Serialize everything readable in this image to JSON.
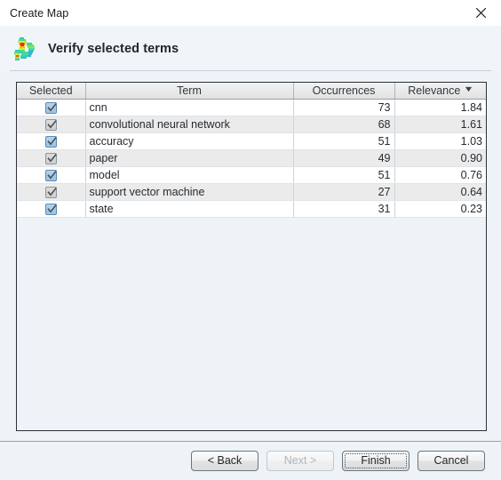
{
  "window": {
    "title": "Create Map",
    "close_icon": "close-icon"
  },
  "header": {
    "title": "Verify selected terms",
    "icon": "density-map-icon"
  },
  "table": {
    "columns": [
      {
        "key": "selected",
        "label": "Selected"
      },
      {
        "key": "term",
        "label": "Term"
      },
      {
        "key": "occurrences",
        "label": "Occurrences"
      },
      {
        "key": "relevance",
        "label": "Relevance"
      }
    ],
    "sort": {
      "column": "relevance",
      "direction": "descending",
      "icon": "chevron-down-icon",
      "glyph": "▼"
    },
    "rows": [
      {
        "selected": true,
        "term": "cnn",
        "occurrences": "73",
        "relevance": "1.84"
      },
      {
        "selected": true,
        "term": "convolutional neural network",
        "occurrences": "68",
        "relevance": "1.61"
      },
      {
        "selected": true,
        "term": "accuracy",
        "occurrences": "51",
        "relevance": "1.03"
      },
      {
        "selected": true,
        "term": "paper",
        "occurrences": "49",
        "relevance": "0.90"
      },
      {
        "selected": true,
        "term": "model",
        "occurrences": "51",
        "relevance": "0.76"
      },
      {
        "selected": true,
        "term": "support vector machine",
        "occurrences": "27",
        "relevance": "0.64"
      },
      {
        "selected": true,
        "term": "state",
        "occurrences": "31",
        "relevance": "0.23"
      }
    ]
  },
  "footer": {
    "buttons": [
      {
        "id": "back",
        "label": "< Back",
        "enabled": true,
        "focused": false
      },
      {
        "id": "next",
        "label": "Next >",
        "enabled": false,
        "focused": false
      },
      {
        "id": "finish",
        "label": "Finish",
        "enabled": true,
        "focused": true
      },
      {
        "id": "cancel",
        "label": "Cancel",
        "enabled": true,
        "focused": false
      }
    ]
  },
  "colors": {
    "window_background": "#eef3f7",
    "titlebar_background": "#ffffff",
    "header_background": "#f1f5f9",
    "table_border": "#2b3137",
    "row_odd": "#ffffff",
    "row_even": "#ebebeb",
    "checkbox_accent": "#9cc3e2",
    "text": "#262b30"
  }
}
